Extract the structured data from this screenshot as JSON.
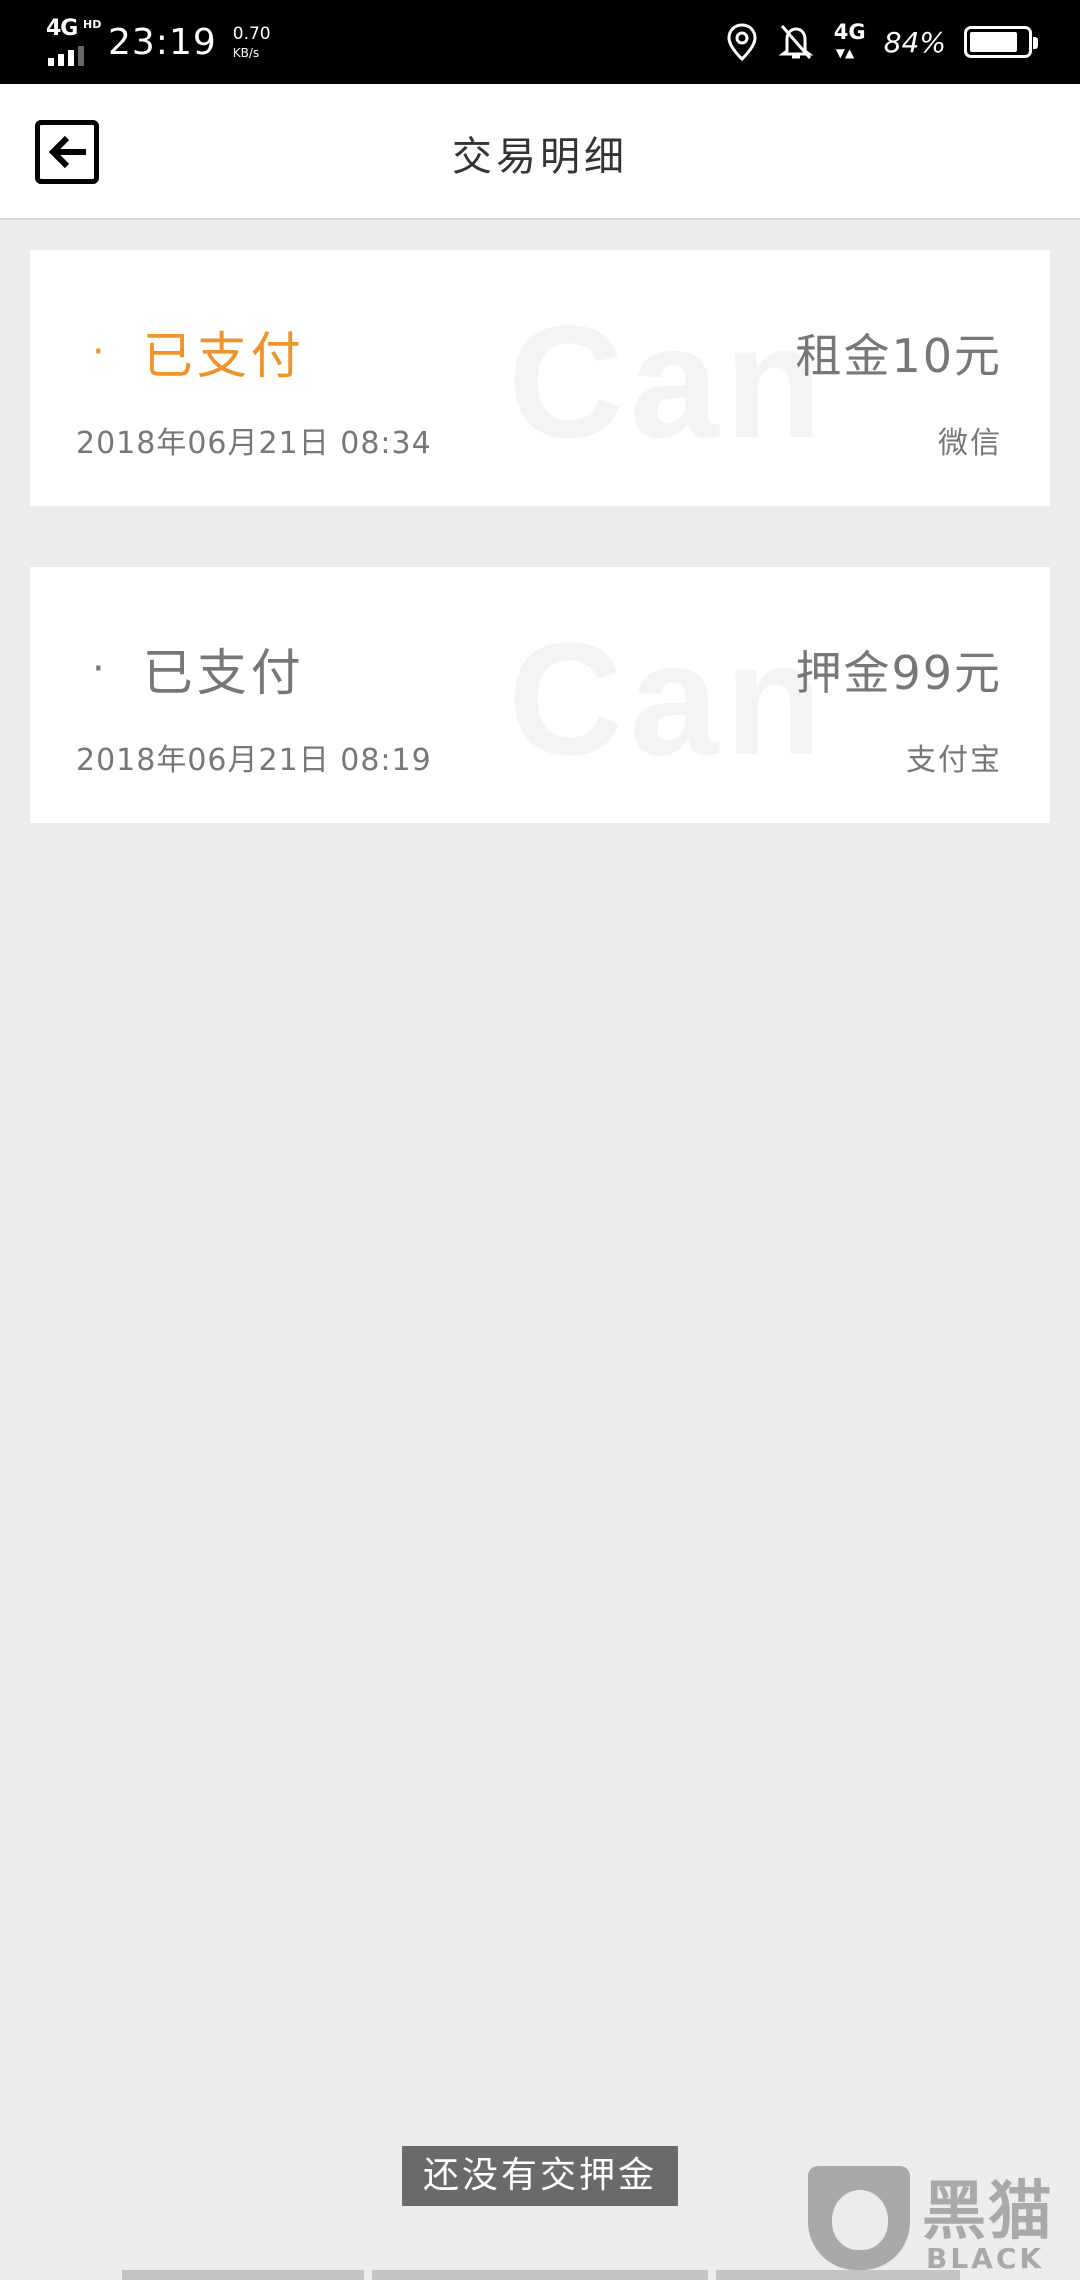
{
  "status_bar": {
    "network": "4G",
    "network_badge": "HD",
    "time": "23:19",
    "speed_value": "0.70",
    "speed_unit": "KB/s",
    "data_network": "4G",
    "battery_text": "84%",
    "battery_level": 0.84,
    "icons": [
      "location-icon",
      "bell-off-icon"
    ]
  },
  "header": {
    "title": "交易明细",
    "back_icon": "arrow-left-icon"
  },
  "transactions": [
    {
      "status": "已支付",
      "status_color": "#f0932b",
      "date": "2018年06月21日 08:34",
      "amount": "租金10元",
      "method": "微信",
      "watermark": "Can Go"
    },
    {
      "status": "已支付",
      "status_color": "#777777",
      "date": "2018年06月21日 08:19",
      "amount": "押金99元",
      "method": "支付宝",
      "watermark": "Can Go"
    }
  ],
  "toast": {
    "text": "还没有交押金"
  },
  "logo": {
    "cn": "黑猫",
    "en": "BLACK CAT"
  },
  "colors": {
    "accent": "#f0932b",
    "background": "#ededed",
    "card": "#ffffff"
  }
}
